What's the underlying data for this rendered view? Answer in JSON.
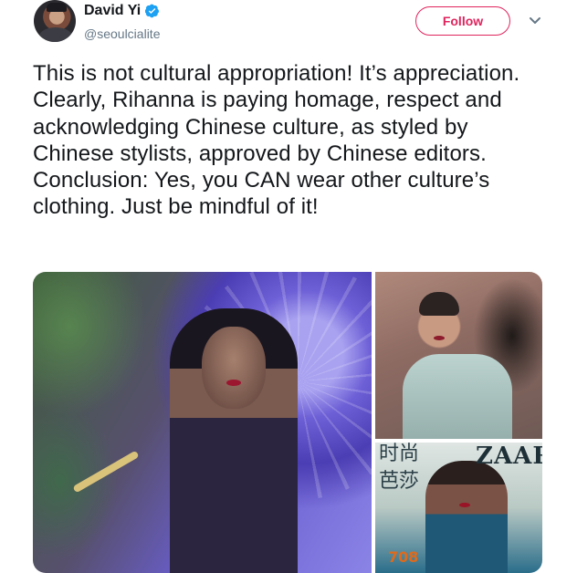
{
  "user": {
    "display_name": "David Yi",
    "handle": "@seoulcialite",
    "verified": true,
    "avatar_icon": "profile-photo"
  },
  "actions": {
    "follow_label": "Follow",
    "menu_icon": "chevron-down-icon"
  },
  "tweet": {
    "text": "This is not cultural appropriation! It’s appreciation. Clearly, Rihanna is paying homage, respect and acknowledging Chinese culture, as styled by Chinese stylists, approved by Chinese editors. Conclusion: Yes, you CAN wear other culture’s clothing. Just be mindful of it!"
  },
  "media": {
    "cover": {
      "title": "ZAAR",
      "chinese_line1": "时尚",
      "chinese_line2": "芭莎",
      "number": "708"
    }
  },
  "colors": {
    "accent": "#e0245e",
    "verified": "#1da1f2",
    "secondary_text": "#657786"
  }
}
